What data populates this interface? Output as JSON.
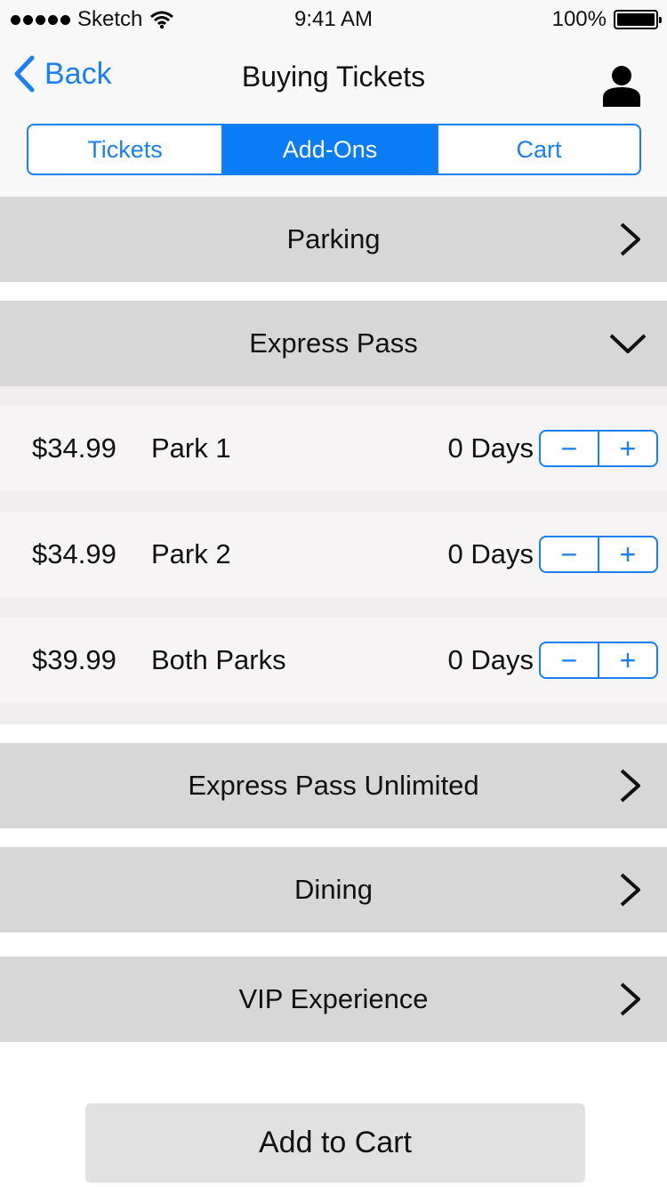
{
  "status_bar": {
    "carrier": "Sketch",
    "time": "9:41 AM",
    "battery": "100%"
  },
  "nav": {
    "back_label": "Back",
    "title": "Buying Tickets"
  },
  "tabs": [
    {
      "label": "Tickets"
    },
    {
      "label": "Add-Ons"
    },
    {
      "label": "Cart"
    }
  ],
  "sections": {
    "parking": "Parking",
    "express_pass": "Express Pass",
    "express_pass_unlimited": "Express Pass Unlimited",
    "dining": "Dining",
    "vip": "VIP Experience"
  },
  "express_items": [
    {
      "price": "$34.99",
      "name": "Park 1",
      "days": "0 Days"
    },
    {
      "price": "$34.99",
      "name": "Park 2",
      "days": "0 Days"
    },
    {
      "price": "$39.99",
      "name": "Both Parks",
      "days": "0 Days"
    }
  ],
  "stepper": {
    "minus": "−",
    "plus": "+"
  },
  "add_to_cart_label": "Add to Cart",
  "colors": {
    "accent": "#1a7ff0",
    "section_bg": "#d7d7d7",
    "item_bg": "#f6f4f4"
  }
}
